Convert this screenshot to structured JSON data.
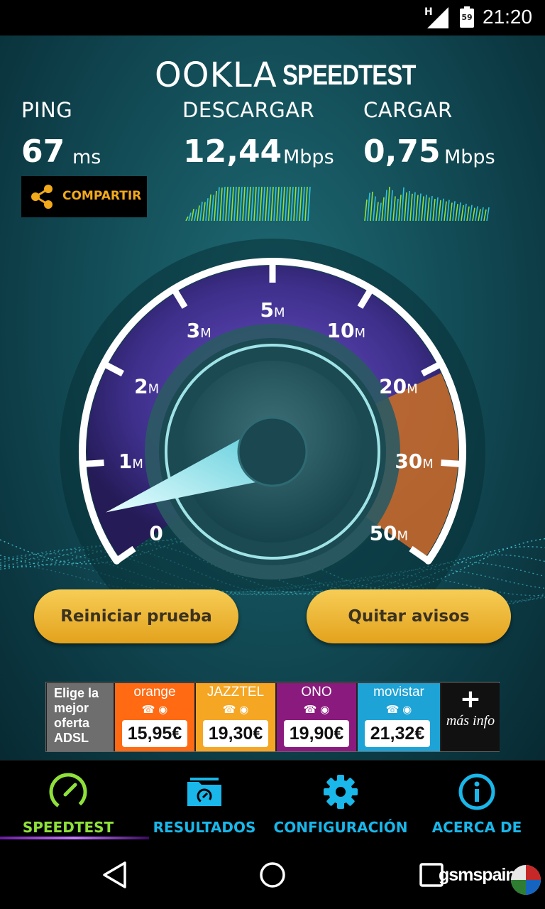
{
  "status_bar": {
    "network_type": "H",
    "battery_level": "59",
    "time": "21:20"
  },
  "brand": {
    "ookla": "OOKLA",
    "speedtest": "SPEEDTEST"
  },
  "metrics": {
    "ping": {
      "label": "PING",
      "value": "67",
      "unit": "ms"
    },
    "download": {
      "label": "DESCARGAR",
      "value": "12,44",
      "unit": "Mbps"
    },
    "upload": {
      "label": "CARGAR",
      "value": "0,75",
      "unit": "Mbps"
    }
  },
  "share": {
    "label": "COMPARTIR",
    "color": "#f2a91c"
  },
  "gauge": {
    "labels": [
      {
        "num": "0",
        "unit": ""
      },
      {
        "num": "1",
        "unit": "M"
      },
      {
        "num": "2",
        "unit": "M"
      },
      {
        "num": "3",
        "unit": "M"
      },
      {
        "num": "5",
        "unit": "M"
      },
      {
        "num": "10",
        "unit": "M"
      },
      {
        "num": "20",
        "unit": "M"
      },
      {
        "num": "30",
        "unit": "M"
      },
      {
        "num": "50",
        "unit": "M"
      }
    ],
    "needle_fraction": 0.06
  },
  "buttons": {
    "restart": "Reiniciar prueba",
    "remove_ads": "Quitar avisos"
  },
  "ad": {
    "intro": "Elige la mejor oferta ADSL",
    "offers": [
      {
        "brand": "orange",
        "price": "15,95€",
        "bg": "#ff6a12"
      },
      {
        "brand": "JAZZTEL",
        "price": "19,30€",
        "bg": "#f5a623"
      },
      {
        "brand": "ONO",
        "price": "19,90€",
        "bg": "#8b1a7e"
      },
      {
        "brand": "movistar",
        "price": "21,32€",
        "bg": "#1ea3d6"
      }
    ],
    "more_plus": "+",
    "more_text": "más info"
  },
  "tabs": [
    {
      "label": "SPEEDTEST",
      "icon": "speedometer-icon",
      "color": "#8fe13a",
      "active": true
    },
    {
      "label": "RESULTADOS",
      "icon": "results-folder-icon",
      "color": "#19b7ea"
    },
    {
      "label": "CONFIGURACIÓN",
      "icon": "gear-icon",
      "color": "#19b7ea"
    },
    {
      "label": "ACERCA DE",
      "icon": "info-icon",
      "color": "#19b7ea"
    }
  ],
  "watermark": "gsmspain",
  "colors": {
    "accent_orange": "#f2a91c",
    "active_green": "#8fe13a",
    "tab_blue": "#19b7ea",
    "gauge_purple": "#4a3a9a",
    "gauge_orange": "#e07a2e"
  }
}
